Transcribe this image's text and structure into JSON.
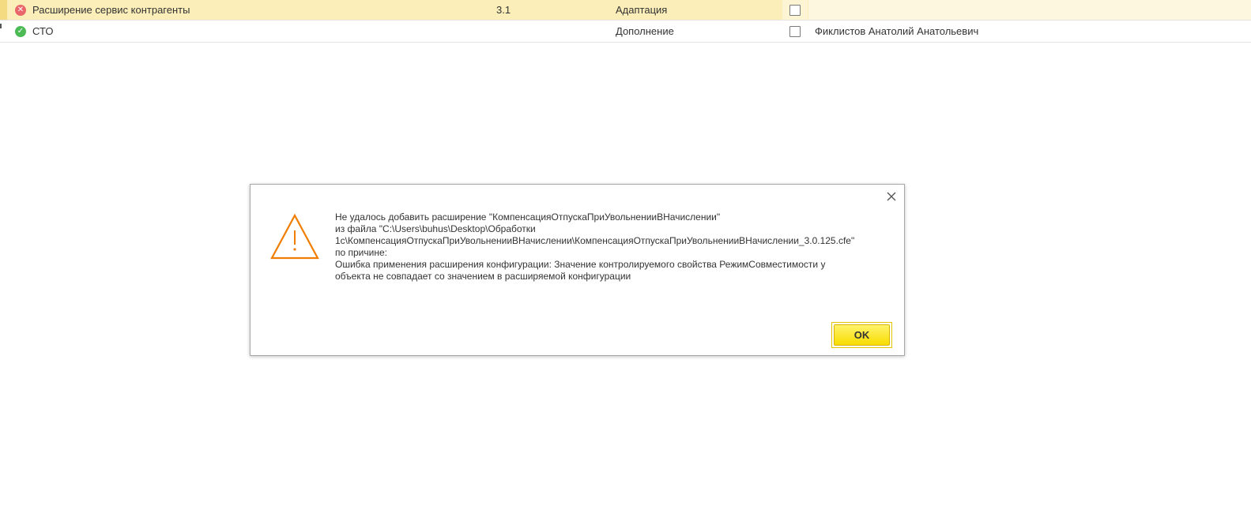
{
  "table": {
    "rows": [
      {
        "status_icon": "error-circle-icon",
        "name": "Расширение сервис контрагенты",
        "version": "3.1",
        "purpose": "Адаптация",
        "checked": false,
        "author": ""
      },
      {
        "status_icon": "ok-circle-icon",
        "name": "СТО",
        "version": "",
        "purpose": "Дополнение",
        "checked": false,
        "author": "Фиклистов Анатолий Анатольевич"
      }
    ]
  },
  "dialog": {
    "icon": "warning-triangle-icon",
    "close_icon": "close-icon",
    "message_lines": [
      "Не удалось добавить расширение \"КомпенсацияОтпускаПриУвольненииВНачислении\"",
      "из файла \"C:\\Users\\buhus\\Desktop\\Обработки",
      "1с\\КомпенсацияОтпускаПриУвольненииВНачислении\\КомпенсацияОтпускаПриУвольненииВНачислении_3.0.125.cfe\"",
      "по причине:",
      "Ошибка применения расширения конфигурации: Значение контролируемого свойства РежимСовместимости у",
      "объекта  не совпадает со значением в расширяемой конфигурации"
    ],
    "ok_label": "OK"
  },
  "colors": {
    "selected_row": "#fbeeb8",
    "warning": "#f07d00",
    "ok_button": "#f8dc00",
    "status_error": "#e9676b",
    "status_ok": "#4cbb56"
  }
}
